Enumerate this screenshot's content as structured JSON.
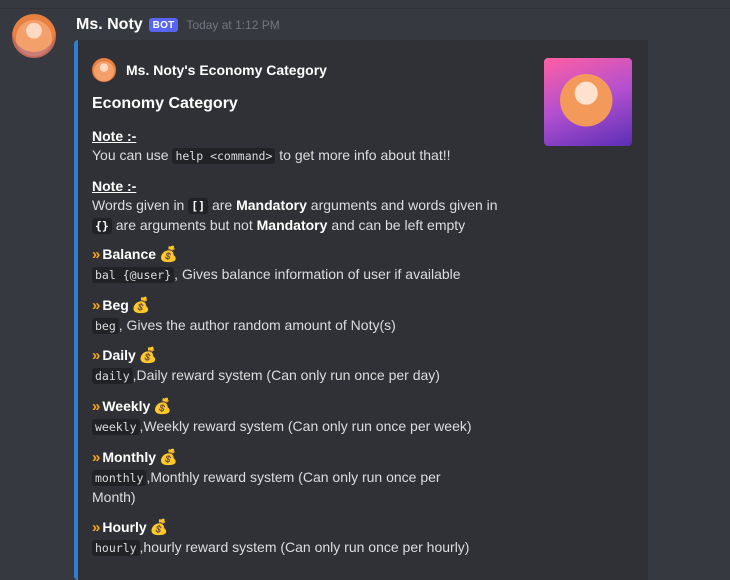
{
  "message": {
    "username": "Ms. Noty",
    "bot_tag": "BOT",
    "timestamp": "Today at 1:12 PM"
  },
  "embed": {
    "accent_color": "#2d7fcf",
    "author": "Ms. Noty's Economy Category",
    "title": "Economy Category",
    "note1": {
      "heading": "Note :-",
      "prefix": "You can use",
      "code": "help <command>",
      "suffix": "to get more info about that!!"
    },
    "note2": {
      "heading": "Note :-",
      "p1": "Words given in",
      "c1": "[]",
      "p2": "are",
      "b1": "Mandatory",
      "p3": "arguments and words given in",
      "c2": "{}",
      "p4": "are arguments but not",
      "b2": "Mandatory",
      "p5": "and can be left empty"
    },
    "commands": [
      {
        "name": "Balance",
        "code": "bal {@user}",
        "desc": ", Gives balance information of user if available"
      },
      {
        "name": "Beg",
        "code": "beg",
        "desc": ", Gives the author random amount of Noty(s)"
      },
      {
        "name": "Daily",
        "code": "daily",
        "desc": ",Daily reward system (Can only run once per day)"
      },
      {
        "name": "Weekly",
        "code": "weekly",
        "desc": ",Weekly reward system (Can only run once per week)"
      },
      {
        "name": "Monthly",
        "code": "monthly",
        "desc": ",Monthly reward system (Can only run once per Month)"
      },
      {
        "name": "Hourly",
        "code": "hourly",
        "desc": ",hourly reward system (Can only run once per hourly)"
      }
    ],
    "icons": {
      "chevron": "»",
      "money_bag": "💰"
    }
  }
}
